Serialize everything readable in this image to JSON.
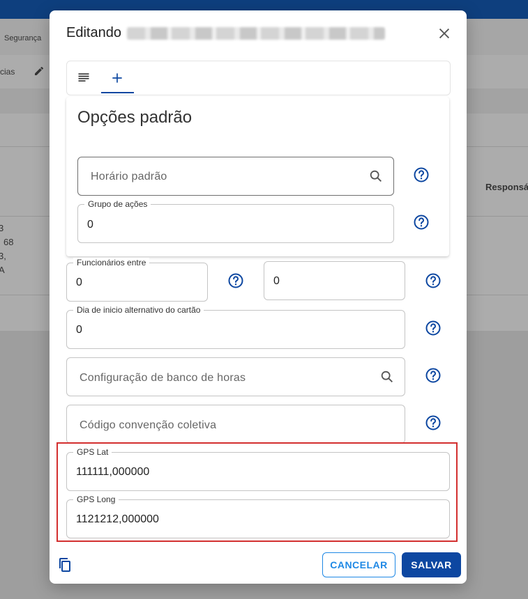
{
  "background": {
    "nav_fragment": "Segurança",
    "toolbar_fragment": "cias",
    "column_header": "Responsá",
    "row_fragments": [
      "3",
      "68",
      "3,",
      "A"
    ]
  },
  "modal": {
    "title": "Editando",
    "tabs": [
      {
        "icon": "lines-icon"
      },
      {
        "icon": "plus-icon",
        "active": true
      }
    ],
    "section_title": "Opções padrão",
    "fields": {
      "horario_padrao": {
        "placeholder": "Horário padrão"
      },
      "grupo_acoes": {
        "label": "Grupo de ações",
        "value": "0"
      },
      "funcionarios_entre": {
        "label": "Funcionários entre",
        "value": "0",
        "value2": "0"
      },
      "dia_inicio": {
        "label": "Dia de inicio alternativo do cartão",
        "value": "0"
      },
      "banco_horas": {
        "placeholder": "Configuração de banco de horas"
      },
      "convencao": {
        "placeholder": "Código convenção coletiva"
      },
      "gps_lat": {
        "label": "GPS Lat",
        "value": "111111,000000"
      },
      "gps_long": {
        "label": "GPS Long",
        "value": "1121212,000000"
      }
    },
    "buttons": {
      "cancel": "CANCELAR",
      "save": "SALVAR"
    }
  },
  "colors": {
    "primary": "#0d47a1",
    "cancel_outline": "#1e88e5",
    "highlight": "#d32f2f",
    "topbar": "#0e3f7e"
  }
}
